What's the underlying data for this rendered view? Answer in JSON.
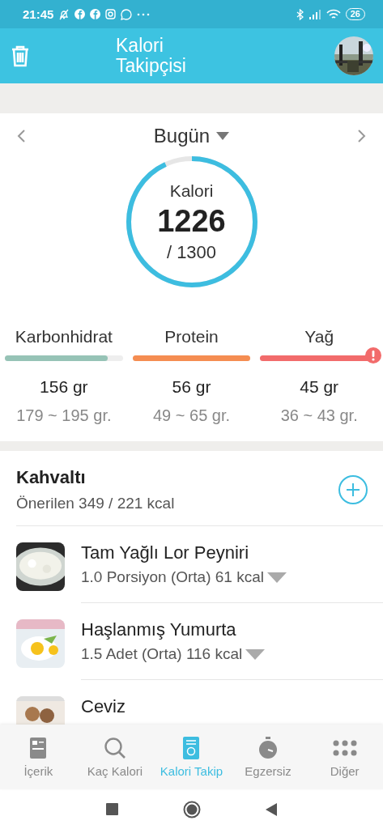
{
  "status_bar": {
    "time": "21:45",
    "battery": "26"
  },
  "header": {
    "title": "Kalori Takipçisi"
  },
  "day_selector": {
    "label": "Bugün"
  },
  "calories": {
    "label": "Kalori",
    "value": "1226",
    "goal": "/ 1300"
  },
  "macros": [
    {
      "name": "Karbonhidrat",
      "level": 0.87,
      "color": "#96c3b6",
      "amount": "156 gr",
      "range": "179 ~ 195 gr.",
      "warning": false
    },
    {
      "name": "Protein",
      "level": 1,
      "color": "#f58d52",
      "amount": "56 gr",
      "range": "49 ~ 65 gr.",
      "warning": false
    },
    {
      "name": "Yağ",
      "level": 1,
      "color": "#f26b6b",
      "amount": "45 gr",
      "range": "36 ~ 43 gr.",
      "warning": true
    }
  ],
  "meal": {
    "title": "Kahvaltı",
    "subtitle": "Önerilen 349 / 221 kcal",
    "foods": [
      {
        "name": "Tam Yağlı Lor Peyniri",
        "portion": "1.0 Porsiyon (Orta) 61 kcal"
      },
      {
        "name": "Haşlanmış Yumurta",
        "portion": "1.5 Adet (Orta) 116 kcal"
      },
      {
        "name": "Ceviz"
      }
    ]
  },
  "bottom_nav": [
    {
      "label": "İçerik",
      "selected": false
    },
    {
      "label": "Kaç Kalori",
      "selected": false
    },
    {
      "label": "Kalori Takip",
      "selected": true
    },
    {
      "label": "Egzersiz",
      "selected": false
    },
    {
      "label": "Diğer",
      "selected": false
    }
  ]
}
